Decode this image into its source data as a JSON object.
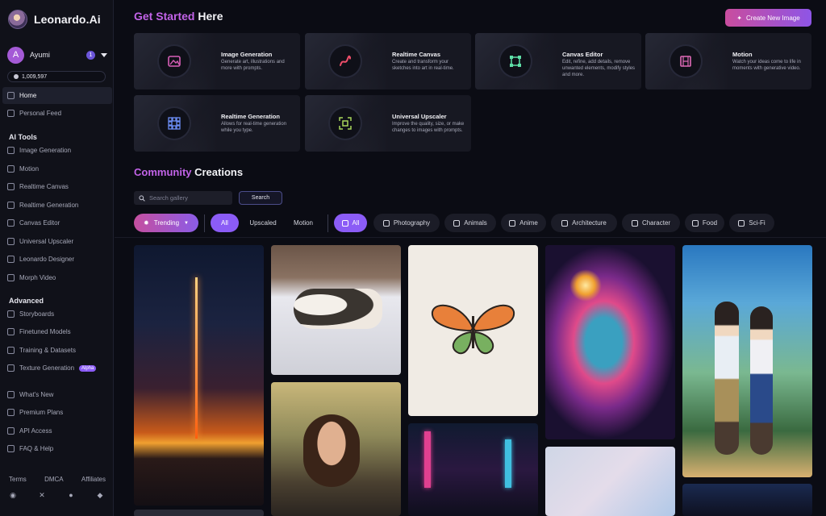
{
  "app": {
    "logo_text": "Leonardo.Ai"
  },
  "user": {
    "avatar_letter": "A",
    "name": "Ayumi",
    "notifications": "1",
    "tokens": "1,009,597"
  },
  "nav": {
    "home": "Home",
    "personal_feed": "Personal Feed",
    "ai_tools_heading": "AI Tools",
    "ai_tools": [
      "Image Generation",
      "Motion",
      "Realtime Canvas",
      "Realtime Generation",
      "Canvas Editor",
      "Universal Upscaler",
      "Leonardo Designer",
      "Morph Video"
    ],
    "advanced_heading": "Advanced",
    "advanced": [
      "Storyboards",
      "Finetuned Models",
      "Training & Datasets",
      "Texture Generation"
    ],
    "alpha_badge": "Alpha",
    "misc": [
      "What's New",
      "Premium Plans",
      "API Access",
      "FAQ & Help"
    ],
    "footer": [
      "Terms",
      "DMCA",
      "Affiliates"
    ],
    "social_icons": [
      "discord-icon",
      "x-icon",
      "facebook-icon",
      "apple-icon"
    ]
  },
  "header": {
    "title_accent": "Get Started",
    "title_rest": " Here",
    "create_button": "Create New Image"
  },
  "tools": [
    {
      "title": "Image Generation",
      "desc": "Generate art, illustrations and more with prompts.",
      "icon_color": "#d95fb8"
    },
    {
      "title": "Realtime Canvas",
      "desc": "Create and transform your sketches into art in real-time.",
      "icon_color": "#ef4e6a"
    },
    {
      "title": "Canvas Editor",
      "desc": "Edit, refine, add details, remove unwanted elements, modify styles and more.",
      "icon_color": "#5fe0a8"
    },
    {
      "title": "Motion",
      "desc": "Watch your ideas come to life in moments with generative video.",
      "icon_color": "#e06ab8"
    },
    {
      "title": "Realtime Generation",
      "desc": "Allows for real-time generation while you type.",
      "icon_color": "#6b8cf2"
    },
    {
      "title": "Universal Upscaler",
      "desc": "Improve the quality, size, or make changes to images with prompts.",
      "icon_color": "#a8d65a"
    }
  ],
  "community": {
    "title_accent": "Community",
    "title_rest": " Creations",
    "search_placeholder": "Search gallery",
    "search_button": "Search",
    "trending": "Trending",
    "tabs": [
      "All",
      "Upscaled",
      "Motion"
    ],
    "categories": [
      "All",
      "Photography",
      "Animals",
      "Anime",
      "Architecture",
      "Character",
      "Food",
      "Sci-Fi"
    ]
  },
  "colors": {
    "accent_pink": "#c94d9e",
    "accent_purple": "#8b5cf6",
    "background": "#0b0c14"
  }
}
